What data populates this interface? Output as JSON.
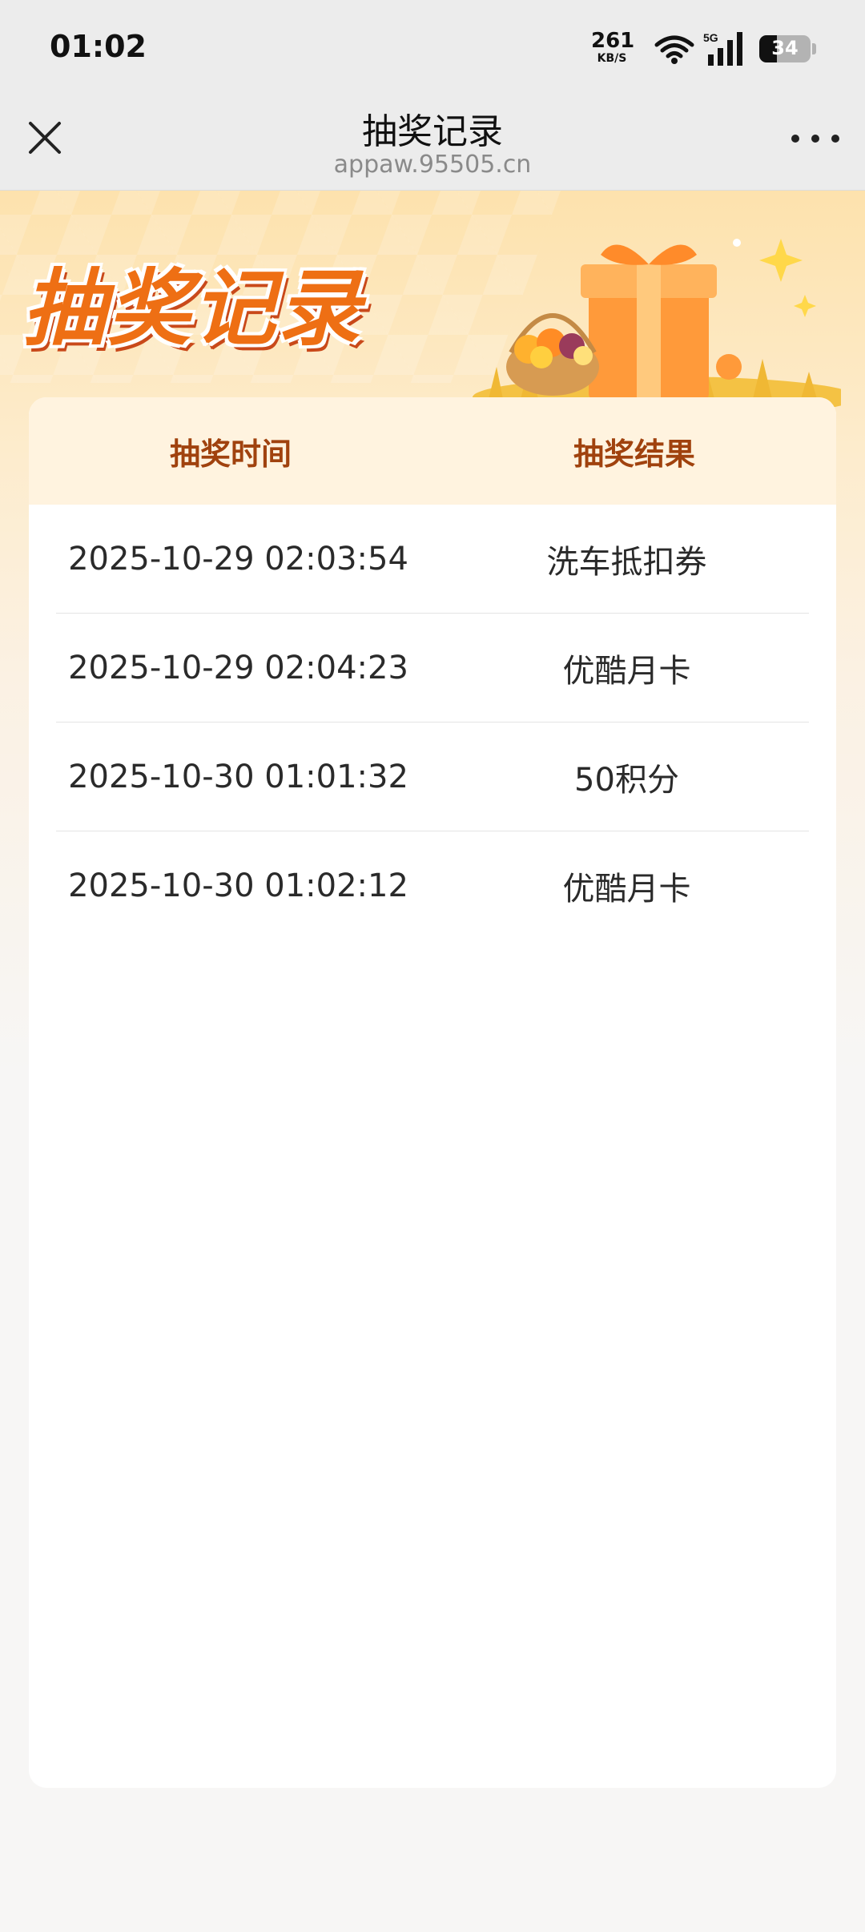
{
  "status_bar": {
    "time": "01:02",
    "net_speed_value": "261",
    "net_speed_unit": "KB/S",
    "network_type": "5G",
    "battery": "34"
  },
  "nav": {
    "title": "抽奖记录",
    "url": "appaw.95505.cn"
  },
  "hero": {
    "title": "抽奖记录"
  },
  "table": {
    "headers": [
      "抽奖时间",
      "抽奖结果"
    ],
    "rows": [
      {
        "time": "2025-10-29 02:03:54",
        "result": "洗车抵扣券"
      },
      {
        "time": "2025-10-29 02:04:23",
        "result": "优酷月卡"
      },
      {
        "time": "2025-10-30 01:01:32",
        "result": "50积分"
      },
      {
        "time": "2025-10-30 01:02:12",
        "result": "优酷月卡"
      }
    ]
  },
  "colors": {
    "accent": "#ee6f14",
    "header_text": "#a0420e",
    "header_bg": "#fff3df"
  }
}
